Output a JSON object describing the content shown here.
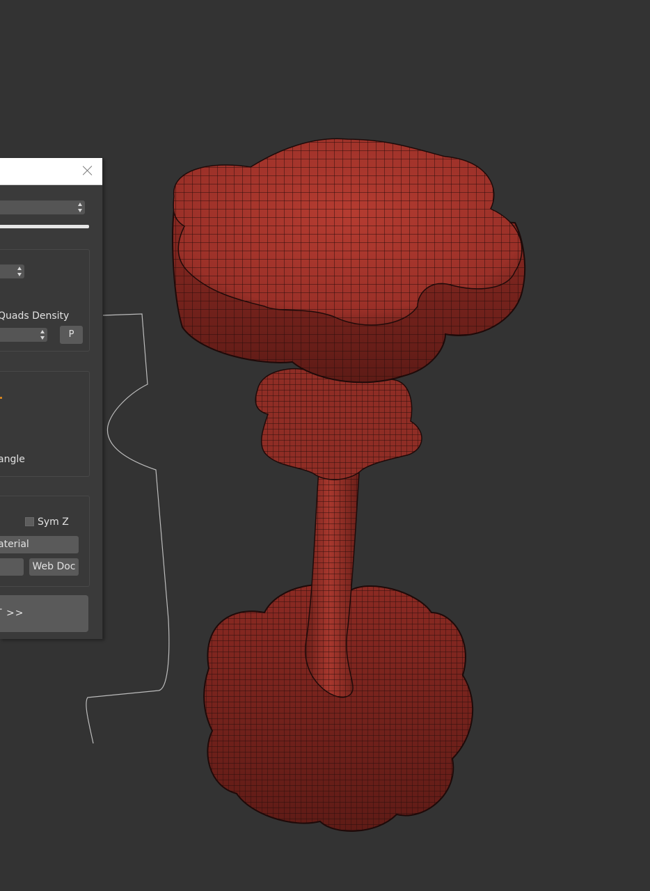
{
  "viewport": {
    "background_color": "#333333",
    "mesh_color": "#a3352c",
    "wire_color": "#2a0e0c",
    "curve_color": "#bdbdbd"
  },
  "panel": {
    "title": "",
    "close_icon": "close-icon",
    "quads_density_label": "Quads Density",
    "p_button_label": "P",
    "angle_label": "angle",
    "sym_z_label": "Sym Z",
    "material_button_label": "aterial",
    "web_doc_button_label": "Web Doc",
    "big_button_label": "T    >>",
    "accent_color": "#e08a1e",
    "panel_color": "#3a3a3a",
    "control_color": "#555555"
  }
}
